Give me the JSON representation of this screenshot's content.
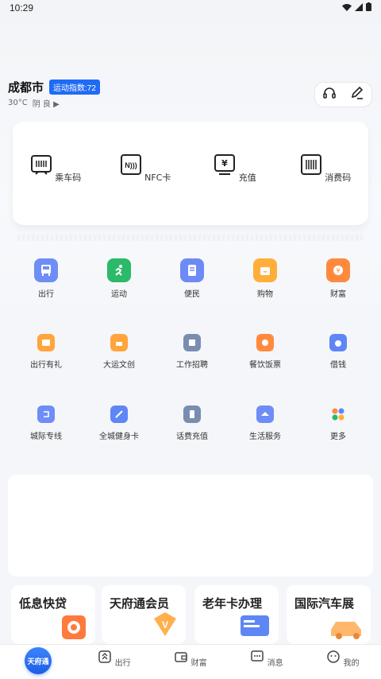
{
  "status_bar": {
    "time": "10:29"
  },
  "header": {
    "city": "成都市",
    "sport_index": "运动指数:72",
    "temperature": "30°C",
    "weather": "阴 良 ▶"
  },
  "quick_pay": [
    {
      "label": "乘车码",
      "icon": "bus-card-icon"
    },
    {
      "label": "NFC卡",
      "icon": "nfc-icon"
    },
    {
      "label": "充值",
      "icon": "yuan-icon"
    },
    {
      "label": "消费码",
      "icon": "barcode-icon"
    }
  ],
  "services": [
    {
      "label": "出行",
      "icon": "bus-icon",
      "color": "#6f8df7"
    },
    {
      "label": "运动",
      "icon": "run-icon",
      "color": "#2bb96a"
    },
    {
      "label": "便民",
      "icon": "doc-icon",
      "color": "#6e8bf5"
    },
    {
      "label": "购物",
      "icon": "bag-icon",
      "color": "#ffae3a"
    },
    {
      "label": "财富",
      "icon": "coin-icon",
      "color": "#ff8a3d"
    },
    {
      "label": "出行有礼",
      "icon": "gift-bus-icon",
      "color": "#ffa53b"
    },
    {
      "label": "大运文创",
      "icon": "box-icon",
      "color": "#ffa53b"
    },
    {
      "label": "工作招聘",
      "icon": "recruit-icon",
      "color": "#7a8cb0"
    },
    {
      "label": "餐饮饭票",
      "icon": "meal-icon",
      "color": "#ff8a3d"
    },
    {
      "label": "借钱",
      "icon": "money-bag-icon",
      "color": "#5f86f5"
    },
    {
      "label": "城际专线",
      "icon": "route-icon",
      "color": "#6f8df7"
    },
    {
      "label": "全城健身卡",
      "icon": "dumbbell-icon",
      "color": "#5f86f5"
    },
    {
      "label": "话费充值",
      "icon": "phone-topup-icon",
      "color": "#7a8cb0"
    },
    {
      "label": "生活服务",
      "icon": "life-service-icon",
      "color": "#6f8df7"
    },
    {
      "label": "更多",
      "icon": "more-apps-icon",
      "color": "#ff8a3d"
    }
  ],
  "promos": [
    {
      "title": "低息快贷"
    },
    {
      "title": "天府通会员"
    },
    {
      "title": "老年卡办理"
    },
    {
      "title": "国际汽车展"
    }
  ],
  "tabbar": {
    "home": "天府通",
    "tabs": [
      {
        "label": "出行"
      },
      {
        "label": "财富"
      },
      {
        "label": "消息"
      },
      {
        "label": "我的"
      }
    ]
  },
  "colors": {
    "accent": "#1f6bf5",
    "background": "#f4f6f9"
  }
}
